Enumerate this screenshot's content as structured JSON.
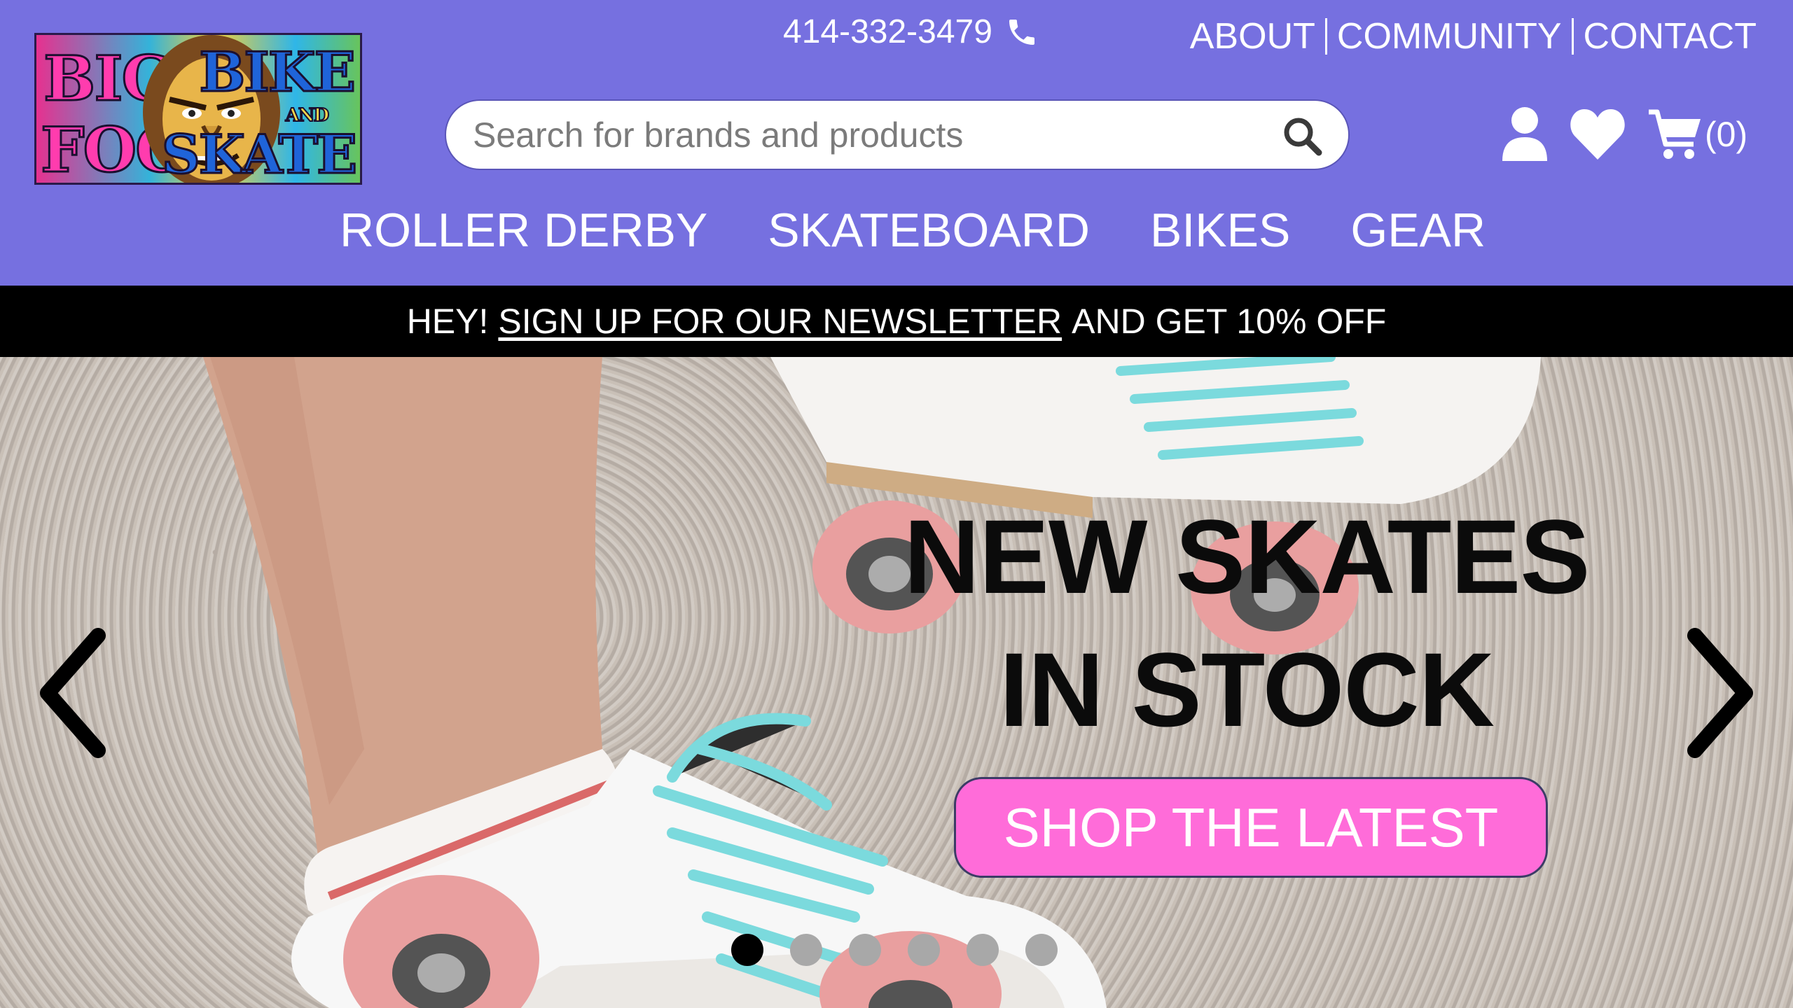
{
  "header": {
    "logo": {
      "line1": "BIG",
      "line2": "FOOT",
      "line3": "BIKE",
      "line4": "AND",
      "line5": "SKATE"
    },
    "phone": "414-332-3479",
    "top_links": [
      "ABOUT",
      "COMMUNITY",
      "CONTACT"
    ],
    "search": {
      "placeholder": "Search for brands and products"
    },
    "cart_count": "(0)",
    "nav": [
      "ROLLER DERBY",
      "SKATEBOARD",
      "BIKES",
      "GEAR"
    ]
  },
  "promo": {
    "prefix": "HEY!",
    "link": "SIGN UP FOR OUR NEWSLETTER",
    "suffix": "AND GET 10% OFF"
  },
  "hero": {
    "title_line1": "NEW SKATES",
    "title_line2": "IN STOCK",
    "cta": "SHOP THE LATEST",
    "slide_count": 6,
    "active_slide": 1
  },
  "colors": {
    "header_bg": "#7670e0",
    "promo_bg": "#000000",
    "cta_bg": "#ff6cd9"
  },
  "icons": [
    "phone-icon",
    "search-icon",
    "user-icon",
    "heart-icon",
    "cart-icon",
    "chevron-left-icon",
    "chevron-right-icon"
  ]
}
